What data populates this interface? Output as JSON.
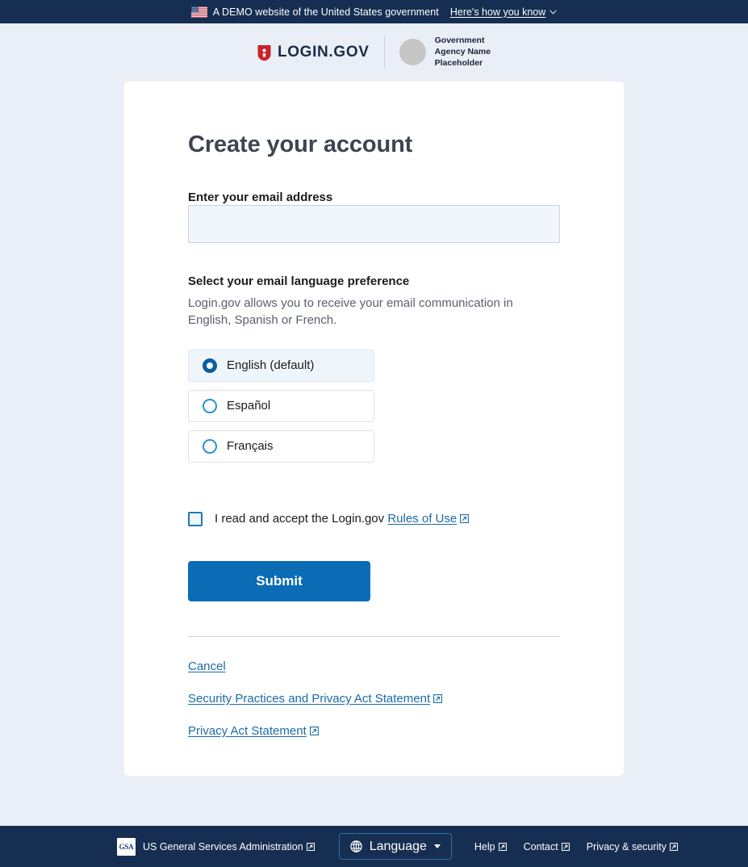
{
  "banner": {
    "flag_icon": "us-flag-icon",
    "text": "A DEMO website of the United States government",
    "how_you_know_label": "Here's how you know",
    "chevron_icon": "chevron-down-icon"
  },
  "header": {
    "shield_icon": "login-gov-shield-icon",
    "brand_name": "LOGIN.GOV",
    "agency_name": "Government\nAgency Name\nPlaceholder",
    "agency_logo_icon": "agency-placeholder-circle-icon"
  },
  "main": {
    "title": "Create your account",
    "email": {
      "label": "Enter your email address",
      "value": "",
      "placeholder": ""
    },
    "language": {
      "title": "Select your email language preference",
      "description": "Login.gov allows you to receive your email communication in English, Spanish or French.",
      "options": [
        {
          "label": "English (default)",
          "selected": true
        },
        {
          "label": "Español",
          "selected": false
        },
        {
          "label": "Français",
          "selected": false
        }
      ]
    },
    "accept": {
      "checked": false,
      "text_before": "I read and accept the Login.gov",
      "link_label": "Rules of Use",
      "external_icon": "external-link-icon"
    },
    "submit_label": "Submit",
    "links": [
      {
        "label": "Cancel",
        "external": false
      },
      {
        "label": "Security Practices and Privacy Act Statement",
        "external": true
      },
      {
        "label": "Privacy Act Statement",
        "external": true
      }
    ]
  },
  "footer": {
    "gsa_logo_text": "GSA",
    "agency_label": "US General Services Administration",
    "language_button": {
      "globe_icon": "globe-icon",
      "label": "Language",
      "caret_icon": "caret-down-icon"
    },
    "links": [
      {
        "label": "Help"
      },
      {
        "label": "Contact"
      },
      {
        "label": "Privacy & security"
      }
    ]
  },
  "colors": {
    "navy": "#162e51",
    "page_bg": "#eaeff7",
    "primary_blue": "#0b6cb5",
    "link_blue": "#1a6ba8",
    "shield_red": "#c9232d"
  }
}
